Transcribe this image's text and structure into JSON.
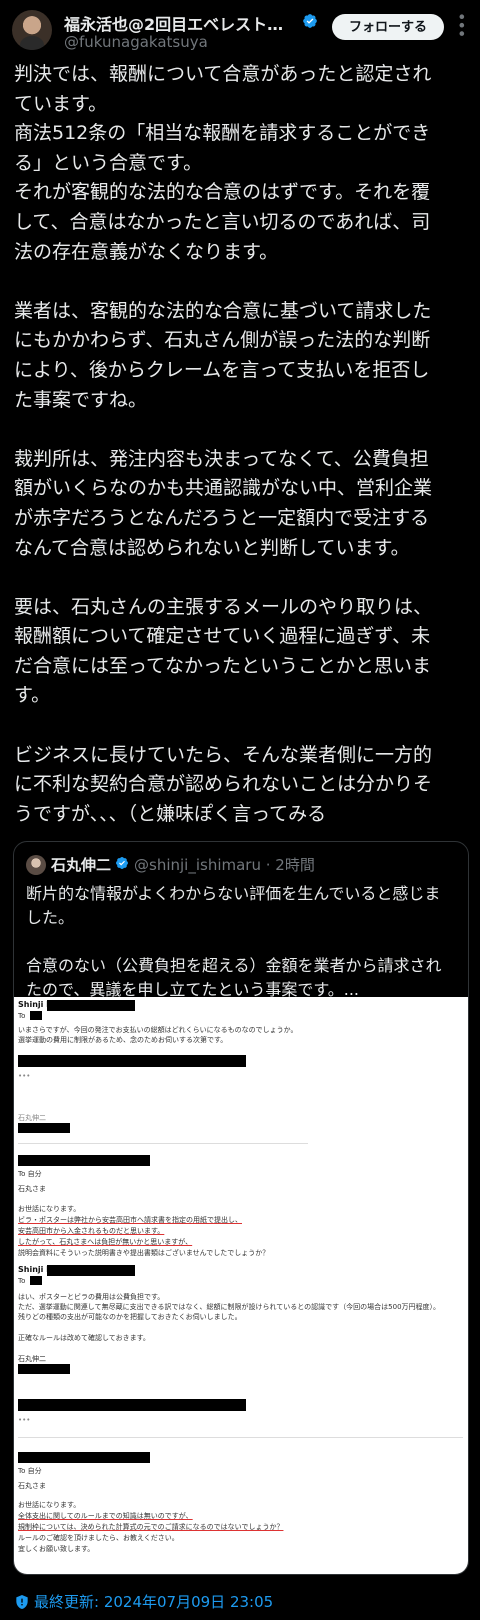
{
  "header": {
    "display_name": "福永活也@2回目エベレスト登…",
    "handle": "@fukunagakatsuya",
    "follow_label": "フォローする",
    "more_icon": "more-dots-icon"
  },
  "tweet": {
    "paragraphs": [
      [
        "判決では、報酬について合意があったと認定され",
        "ています。",
        "商法512条の「相当な報酬を請求することができ",
        "る」という合意です。",
        "それが客観的な法的な合意のはずです。それを覆",
        "して、合意はなかったと言い切るのであれば、司",
        "法の存在意義がなくなります。"
      ],
      [
        "業者は、客観的な法的な合意に基づいて請求した",
        "にもかかわらず、石丸さん側が誤った法的な判断",
        "により、後からクレームを言って支払いを拒否し",
        "た事案ですね。"
      ],
      [
        "裁判所は、発注内容も決まってなくて、公費負担",
        "額がいくらなのかも共通認識がない中、営利企業",
        "が赤字だろうとなんだろうと一定額内で受注する",
        "なんて合意は認められないと判断しています。"
      ],
      [
        "要は、石丸さんの主張するメールのやり取りは、",
        "報酬額について確定させていく過程に過ぎず、未",
        "だ合意には至ってなかったということかと思いま",
        "す。"
      ],
      [
        "ビジネスに長けていたら、そんな業者側に一方的",
        "に不利な契約合意が認められないことは分かりそ",
        "うですが、、、（と嫌味ぽく言ってみる"
      ]
    ]
  },
  "quote": {
    "display_name": "石丸伸二",
    "handle_time": "@shinji_ishimaru · 2時間",
    "text": [
      [
        "断片的な情報がよくわからない評価を生んでいると感じま",
        "した。"
      ],
      [
        "合意のない（公費負担を超える）金額を業者から請求され",
        "たので、異議を申し立てたという事案です。..."
      ]
    ],
    "email": {
      "from1": "Shinji I",
      "to1": "To",
      "body1_l1": "いまさらですが、今回の発注でお支払いの総額はどれくらいになるものなのでしょうか。",
      "body1_l2": "選挙運動の費用に制限があるため、念のためお伺いする次第です。",
      "ellipsis1": "•••",
      "sig1": "石丸伸二",
      "to_me": "To 自分",
      "greet2": "石丸さま",
      "body2_l1": "お世話になります。",
      "body2_l2": "ビラ・ポスターは弊社から安芸高田市へ請求書を指定の用紙で提出し、",
      "body2_l3": "安芸高田市から入金されるものだと思います。",
      "body2_l4": "したがって、石丸さまへは負担が無いかと思いますが、",
      "body2_l5": "説明会資料にそういった説明書きや提出書類はございませんでしたでしょうか？",
      "from3": "Shinji I",
      "to3": "To",
      "body3_l1": "はい、ポスターとビラの費用は公費負担です。",
      "body3_l2": "ただ、選挙運動に関連して無尽蔵に支出できる訳ではなく、総額に制限が設けられているとの認識です（今回の場合は500万円程度）。",
      "body3_l3": "残りどの種類の支出が可能なのかを把握しておきたくお伺いしました。",
      "body3_l4": "正確なルールは改めて確認しておきます。",
      "sig3": "石丸伸二",
      "ellipsis3": "•••",
      "to4": "To 自分",
      "greet4": "石丸さま",
      "body4_l1": "お世話になります。",
      "body4_l2": "全体支出に関してのルールまでの知識は無いのですが、",
      "body4_l3": "規制枠については、決められた計算式の元でのご請求になるのではないでしょうか？",
      "body4_l4": "ルールのご確認を頂けましたら、お教えください。",
      "body4_l5": "宜しくお願い致します。"
    }
  },
  "footer": {
    "updated_label": "最終更新: 2024年07月09日 23:05",
    "updated_icon": "shield-update-icon"
  },
  "colors": {
    "accent": "#1d9bf0",
    "background": "#000000",
    "text": "#e7e9ea",
    "muted": "#71767b"
  }
}
